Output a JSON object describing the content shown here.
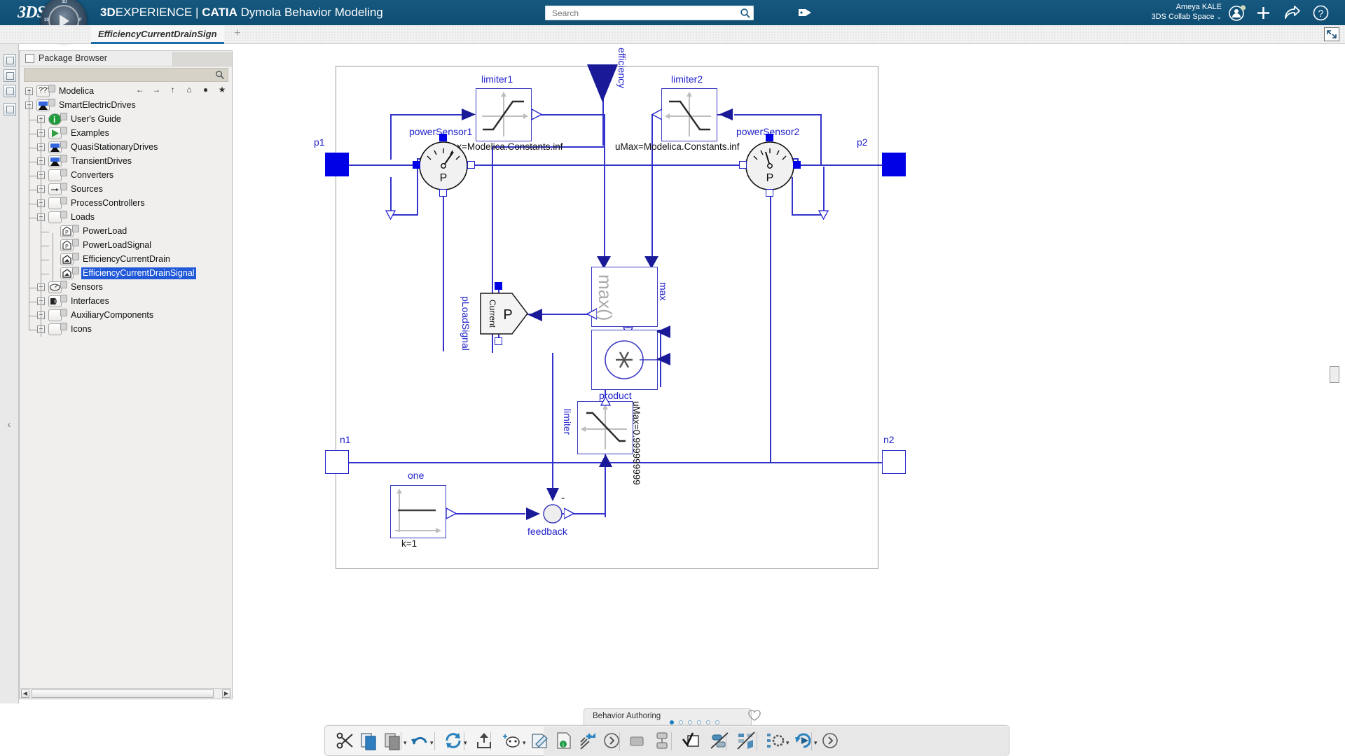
{
  "topbar": {
    "logo": "3DS",
    "compass_icon": "3d-compass-icon",
    "title_bold_1": "3D",
    "title_rest_1": "EXPERIENCE | ",
    "title_bold_2": "CATIA",
    "title_rest_2": " Dymola Behavior Modeling",
    "search_placeholder": "Search",
    "search_value": "",
    "search_icon": "search-icon",
    "tag_icon": "tag-icon",
    "user_name": "Ameya KALE",
    "collab_space": "3DS Collab Space",
    "collab_chevron": "⌄",
    "account_icon": "user-account-icon",
    "add_icon": "plus-icon",
    "share_icon": "share-arrow-icon",
    "help_icon": "question-mark-icon",
    "bg_color": "#14567f"
  },
  "tabstrip": {
    "active_tab": "EfficiencyCurrentDrainSign",
    "add_tab": "+",
    "restore_icon": "restore-window-icon"
  },
  "left_rail": {
    "buttons": [
      "rail-button-1",
      "rail-button-2",
      "rail-button-3",
      "rail-button-4"
    ]
  },
  "browser": {
    "title": "Package Browser",
    "title_icon": "panel-icon",
    "search_icon": "magnifier-icon",
    "nav": {
      "back": "←",
      "forward": "→",
      "up": "↑",
      "home": "⌂",
      "globe": "●",
      "star": "★"
    },
    "scroll_left": "◀",
    "scroll_right": "▶",
    "collapse_handle": "‹",
    "tree": [
      {
        "label": "Modelica",
        "depth": 0,
        "expander": "+",
        "icon": "modelica-icon",
        "selected": false
      },
      {
        "label": "SmartElectricDrives",
        "depth": 0,
        "expander": "−",
        "icon": "package-drive-icon",
        "selected": false
      },
      {
        "label": "User's Guide",
        "depth": 1,
        "expander": "+",
        "icon": "info-icon",
        "selected": false
      },
      {
        "label": "Examples",
        "depth": 1,
        "expander": "+",
        "icon": "play-icon",
        "selected": false
      },
      {
        "label": "QuasiStationaryDrives",
        "depth": 1,
        "expander": "+",
        "icon": "package-drive-icon",
        "selected": false
      },
      {
        "label": "TransientDrives",
        "depth": 1,
        "expander": "+",
        "icon": "package-drive-icon",
        "selected": false
      },
      {
        "label": "Converters",
        "depth": 1,
        "expander": "+",
        "icon": "package-icon",
        "selected": false
      },
      {
        "label": "Sources",
        "depth": 1,
        "expander": "+",
        "icon": "source-arrow-icon",
        "selected": false
      },
      {
        "label": "ProcessControllers",
        "depth": 1,
        "expander": "+",
        "icon": "package-icon",
        "selected": false
      },
      {
        "label": "Loads",
        "depth": 1,
        "expander": "−",
        "icon": "package-icon",
        "selected": false
      },
      {
        "label": "PowerLoad",
        "depth": 2,
        "expander": "",
        "icon": "power-load-icon",
        "selected": false
      },
      {
        "label": "PowerLoadSignal",
        "depth": 2,
        "expander": "",
        "icon": "power-load-icon",
        "selected": false
      },
      {
        "label": "EfficiencyCurrentDrain",
        "depth": 2,
        "expander": "",
        "icon": "model-icon",
        "selected": false
      },
      {
        "label": "EfficiencyCurrentDrainSignal",
        "depth": 2,
        "expander": "",
        "icon": "model-icon",
        "selected": true
      },
      {
        "label": "Sensors",
        "depth": 1,
        "expander": "+",
        "icon": "sensor-icon",
        "selected": false
      },
      {
        "label": "Interfaces",
        "depth": 1,
        "expander": "+",
        "icon": "interface-icon",
        "selected": false
      },
      {
        "label": "AuxiliaryComponents",
        "depth": 1,
        "expander": "+",
        "icon": "package-icon",
        "selected": false
      },
      {
        "label": "Icons",
        "depth": 1,
        "expander": "+",
        "icon": "package-icon",
        "selected": false
      }
    ]
  },
  "diagram": {
    "accent_color": "#2222cc",
    "port_color": "#0000e6",
    "labels": {
      "p1": "p1",
      "p2": "p2",
      "n1": "n1",
      "n2": "n2",
      "efficiency": "efficiency",
      "limiter1": "limiter1",
      "limiter2": "limiter2",
      "limiter1_param": "uMax=Modelica.Constants.inf",
      "limiter2_param": "uMax=Modelica.Constants.inf",
      "powerSensor1": "powerSensor1",
      "powerSensor2": "powerSensor2",
      "sensor_glyph": "P",
      "max_block": "max",
      "max_glyph": "max()",
      "product": "product",
      "product_glyph": "✳",
      "pLoadSignal": "pLoadSignal",
      "current_block_glyph": "Current",
      "current_block_p": "P",
      "limiter": "limiter",
      "limiter_param": "uMax=0.999999999",
      "one": "one",
      "one_param": "k=1",
      "feedback": "feedback",
      "feedback_minus": "-"
    }
  },
  "bottom": {
    "section_tab": "Behavior Authoring",
    "section_dots_total": 6,
    "section_dots_active": 1,
    "favorite_icon": "heart-icon",
    "actions": [
      {
        "name": "cut-button",
        "icon": "scissors-icon",
        "caret": false
      },
      {
        "name": "copy-button",
        "icon": "copy-icon",
        "caret": false
      },
      {
        "name": "paste-button",
        "icon": "paste-icon",
        "caret": true
      },
      {
        "name": "undo-button",
        "icon": "undo-arrow-icon",
        "caret": true
      },
      {
        "name": "update-button",
        "icon": "refresh-cycle-icon",
        "caret": true
      },
      {
        "name": "share-export-button",
        "icon": "upload-box-icon",
        "caret": false
      },
      {
        "name": "new-behavior-button",
        "icon": "new-model-icon",
        "caret": true
      },
      {
        "name": "edit-behavior-button",
        "icon": "edit-model-icon",
        "caret": false
      },
      {
        "name": "properties-button",
        "icon": "info-document-icon",
        "caret": false
      },
      {
        "name": "add-component-button",
        "icon": "add-model-icon",
        "caret": false
      },
      {
        "name": "more-actions-button",
        "icon": "chevron-circle-icon",
        "caret": false
      },
      {
        "name": "rectangle-tool-button",
        "icon": "rectangle-icon",
        "caret": false
      },
      {
        "name": "group-tool-button",
        "icon": "group-shapes-icon",
        "caret": false
      },
      {
        "name": "check-tool-button",
        "icon": "check-square-icon",
        "caret": false
      },
      {
        "name": "hide-connection-button",
        "icon": "hide-connector-icon",
        "caret": false
      },
      {
        "name": "swap-representation-button",
        "icon": "swap-shapes-icon",
        "caret": false
      },
      {
        "name": "configure-button",
        "icon": "gear-diagram-icon",
        "caret": true
      },
      {
        "name": "simulate-button",
        "icon": "simulate-play-icon",
        "caret": true
      },
      {
        "name": "next-section-button",
        "icon": "chevron-right-circle-icon",
        "caret": false
      }
    ]
  }
}
